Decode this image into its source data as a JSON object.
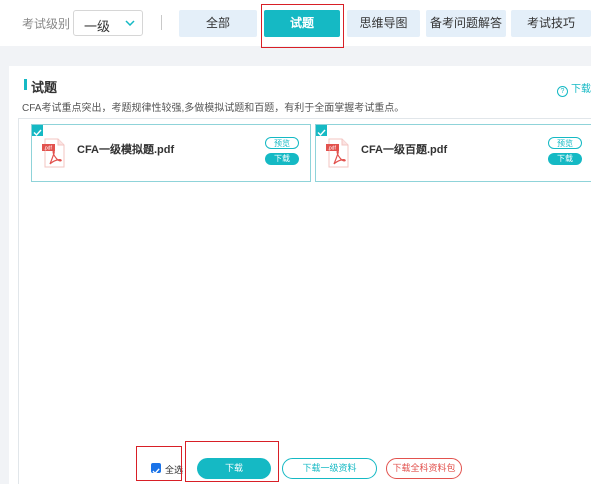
{
  "filter": {
    "level_label": "考试级别",
    "level_value": "一级"
  },
  "tabs": [
    {
      "label": "全部",
      "active": false
    },
    {
      "label": "试题",
      "active": true
    },
    {
      "label": "思维导图",
      "active": false
    },
    {
      "label": "备考问题解答",
      "active": false
    },
    {
      "label": "考试技巧",
      "active": false
    }
  ],
  "section": {
    "title": "试题",
    "help_link": "下载",
    "description": "CFA考试重点突出，考题规律性较强,多做模拟试题和百题，有利于全面掌握考试重点。"
  },
  "files": [
    {
      "name": "CFA一级模拟题.pdf",
      "preview_label": "预览",
      "download_label": "下载",
      "checked": true
    },
    {
      "name": "CFA一级百题.pdf",
      "preview_label": "预览",
      "download_label": "下载",
      "checked": true
    }
  ],
  "pdf_icon_label": ".pdf",
  "bottom": {
    "select_all_label": "全选",
    "download_label": "下载",
    "download_level_label": "下载一级资料",
    "download_all_label": "下载全科资料包"
  },
  "colors": {
    "accent": "#15b9c4",
    "tab_inactive": "#e4eff9",
    "highlight_box": "#d81f26",
    "pdf_red": "#e2524e"
  }
}
